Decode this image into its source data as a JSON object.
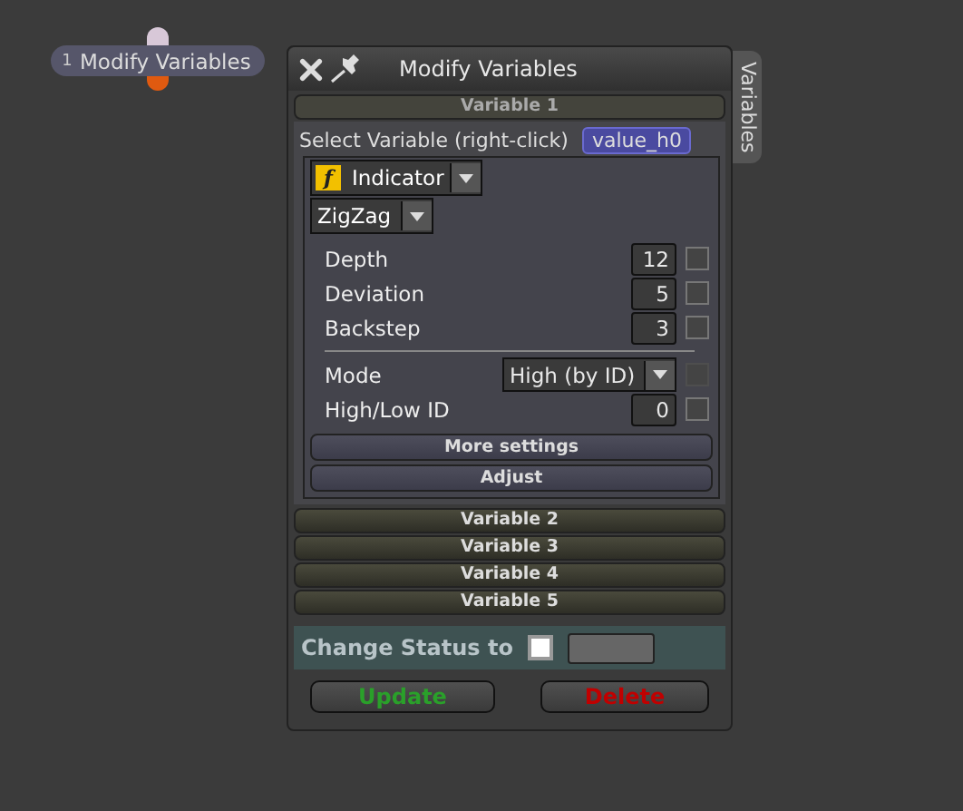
{
  "node": {
    "number": "1",
    "label": "Modify Variables"
  },
  "window": {
    "title": "Modify Variables",
    "side_tab": "Variables"
  },
  "variables": [
    {
      "title": "Variable 1",
      "expanded": true
    },
    {
      "title": "Variable 2",
      "expanded": false
    },
    {
      "title": "Variable 3",
      "expanded": false
    },
    {
      "title": "Variable 4",
      "expanded": false
    },
    {
      "title": "Variable 5",
      "expanded": false
    }
  ],
  "select_label": "Select Variable (right-click)",
  "select_value": "value_h0",
  "source": {
    "icon": "f",
    "value": "Indicator"
  },
  "indicator": "ZigZag",
  "params": [
    {
      "kind": "number",
      "label": "Depth",
      "value": "12",
      "checked": false,
      "disabled": false
    },
    {
      "kind": "number",
      "label": "Deviation",
      "value": "5",
      "checked": false,
      "disabled": false
    },
    {
      "kind": "number",
      "label": "Backstep",
      "value": "3",
      "checked": false,
      "disabled": false
    },
    {
      "kind": "divider"
    },
    {
      "kind": "select",
      "label": "Mode",
      "value": "High (by ID)",
      "checked": false,
      "disabled": true
    },
    {
      "kind": "number",
      "label": "High/Low ID",
      "value": "0",
      "checked": false,
      "disabled": false
    }
  ],
  "settings_buttons": [
    "More settings",
    "Adjust"
  ],
  "status": {
    "label": "Change Status to",
    "checked": false
  },
  "buttons": [
    {
      "label": "Update",
      "kind": "ok"
    },
    {
      "label": "Delete",
      "kind": "danger"
    }
  ]
}
